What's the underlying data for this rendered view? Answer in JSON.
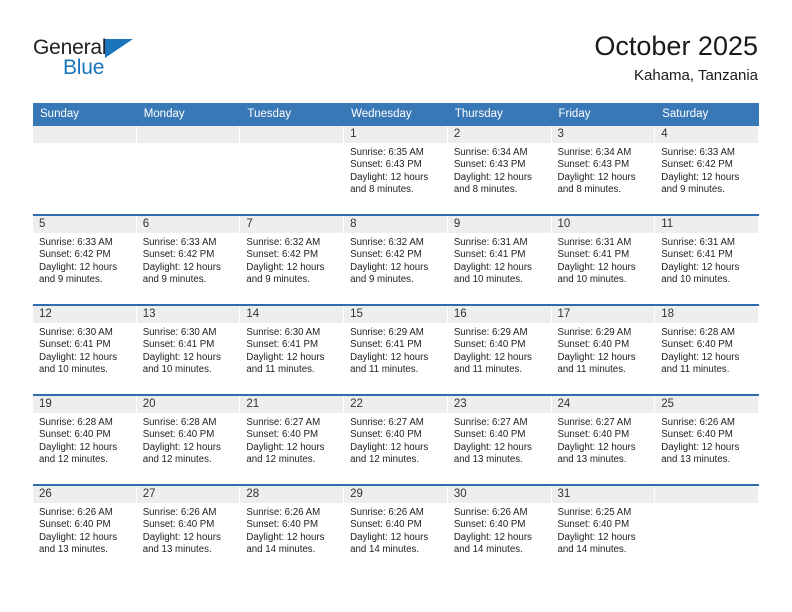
{
  "brand": {
    "name_primary": "General",
    "name_secondary": "Blue",
    "triangle_icon": "triangle-icon",
    "accent_color": "#1b75bb"
  },
  "header": {
    "title": "October 2025",
    "subtitle": "Kahama, Tanzania"
  },
  "colors": {
    "header_row_bg": "#3878b6",
    "week_divider": "#2f6daf",
    "day_band_bg": "#eeeeee",
    "text": "#222222"
  },
  "calendar": {
    "day_headers": [
      "Sunday",
      "Monday",
      "Tuesday",
      "Wednesday",
      "Thursday",
      "Friday",
      "Saturday"
    ],
    "weeks": [
      [
        {
          "day": "",
          "sunrise": "",
          "sunset": "",
          "daylight_line1": "",
          "daylight_line2": "",
          "empty": true
        },
        {
          "day": "",
          "sunrise": "",
          "sunset": "",
          "daylight_line1": "",
          "daylight_line2": "",
          "empty": true
        },
        {
          "day": "",
          "sunrise": "",
          "sunset": "",
          "daylight_line1": "",
          "daylight_line2": "",
          "empty": true
        },
        {
          "day": "1",
          "sunrise": "Sunrise: 6:35 AM",
          "sunset": "Sunset: 6:43 PM",
          "daylight_line1": "Daylight: 12 hours",
          "daylight_line2": "and 8 minutes.",
          "empty": false
        },
        {
          "day": "2",
          "sunrise": "Sunrise: 6:34 AM",
          "sunset": "Sunset: 6:43 PM",
          "daylight_line1": "Daylight: 12 hours",
          "daylight_line2": "and 8 minutes.",
          "empty": false
        },
        {
          "day": "3",
          "sunrise": "Sunrise: 6:34 AM",
          "sunset": "Sunset: 6:43 PM",
          "daylight_line1": "Daylight: 12 hours",
          "daylight_line2": "and 8 minutes.",
          "empty": false
        },
        {
          "day": "4",
          "sunrise": "Sunrise: 6:33 AM",
          "sunset": "Sunset: 6:42 PM",
          "daylight_line1": "Daylight: 12 hours",
          "daylight_line2": "and 9 minutes.",
          "empty": false
        }
      ],
      [
        {
          "day": "5",
          "sunrise": "Sunrise: 6:33 AM",
          "sunset": "Sunset: 6:42 PM",
          "daylight_line1": "Daylight: 12 hours",
          "daylight_line2": "and 9 minutes.",
          "empty": false
        },
        {
          "day": "6",
          "sunrise": "Sunrise: 6:33 AM",
          "sunset": "Sunset: 6:42 PM",
          "daylight_line1": "Daylight: 12 hours",
          "daylight_line2": "and 9 minutes.",
          "empty": false
        },
        {
          "day": "7",
          "sunrise": "Sunrise: 6:32 AM",
          "sunset": "Sunset: 6:42 PM",
          "daylight_line1": "Daylight: 12 hours",
          "daylight_line2": "and 9 minutes.",
          "empty": false
        },
        {
          "day": "8",
          "sunrise": "Sunrise: 6:32 AM",
          "sunset": "Sunset: 6:42 PM",
          "daylight_line1": "Daylight: 12 hours",
          "daylight_line2": "and 9 minutes.",
          "empty": false
        },
        {
          "day": "9",
          "sunrise": "Sunrise: 6:31 AM",
          "sunset": "Sunset: 6:41 PM",
          "daylight_line1": "Daylight: 12 hours",
          "daylight_line2": "and 10 minutes.",
          "empty": false
        },
        {
          "day": "10",
          "sunrise": "Sunrise: 6:31 AM",
          "sunset": "Sunset: 6:41 PM",
          "daylight_line1": "Daylight: 12 hours",
          "daylight_line2": "and 10 minutes.",
          "empty": false
        },
        {
          "day": "11",
          "sunrise": "Sunrise: 6:31 AM",
          "sunset": "Sunset: 6:41 PM",
          "daylight_line1": "Daylight: 12 hours",
          "daylight_line2": "and 10 minutes.",
          "empty": false
        }
      ],
      [
        {
          "day": "12",
          "sunrise": "Sunrise: 6:30 AM",
          "sunset": "Sunset: 6:41 PM",
          "daylight_line1": "Daylight: 12 hours",
          "daylight_line2": "and 10 minutes.",
          "empty": false
        },
        {
          "day": "13",
          "sunrise": "Sunrise: 6:30 AM",
          "sunset": "Sunset: 6:41 PM",
          "daylight_line1": "Daylight: 12 hours",
          "daylight_line2": "and 10 minutes.",
          "empty": false
        },
        {
          "day": "14",
          "sunrise": "Sunrise: 6:30 AM",
          "sunset": "Sunset: 6:41 PM",
          "daylight_line1": "Daylight: 12 hours",
          "daylight_line2": "and 11 minutes.",
          "empty": false
        },
        {
          "day": "15",
          "sunrise": "Sunrise: 6:29 AM",
          "sunset": "Sunset: 6:41 PM",
          "daylight_line1": "Daylight: 12 hours",
          "daylight_line2": "and 11 minutes.",
          "empty": false
        },
        {
          "day": "16",
          "sunrise": "Sunrise: 6:29 AM",
          "sunset": "Sunset: 6:40 PM",
          "daylight_line1": "Daylight: 12 hours",
          "daylight_line2": "and 11 minutes.",
          "empty": false
        },
        {
          "day": "17",
          "sunrise": "Sunrise: 6:29 AM",
          "sunset": "Sunset: 6:40 PM",
          "daylight_line1": "Daylight: 12 hours",
          "daylight_line2": "and 11 minutes.",
          "empty": false
        },
        {
          "day": "18",
          "sunrise": "Sunrise: 6:28 AM",
          "sunset": "Sunset: 6:40 PM",
          "daylight_line1": "Daylight: 12 hours",
          "daylight_line2": "and 11 minutes.",
          "empty": false
        }
      ],
      [
        {
          "day": "19",
          "sunrise": "Sunrise: 6:28 AM",
          "sunset": "Sunset: 6:40 PM",
          "daylight_line1": "Daylight: 12 hours",
          "daylight_line2": "and 12 minutes.",
          "empty": false
        },
        {
          "day": "20",
          "sunrise": "Sunrise: 6:28 AM",
          "sunset": "Sunset: 6:40 PM",
          "daylight_line1": "Daylight: 12 hours",
          "daylight_line2": "and 12 minutes.",
          "empty": false
        },
        {
          "day": "21",
          "sunrise": "Sunrise: 6:27 AM",
          "sunset": "Sunset: 6:40 PM",
          "daylight_line1": "Daylight: 12 hours",
          "daylight_line2": "and 12 minutes.",
          "empty": false
        },
        {
          "day": "22",
          "sunrise": "Sunrise: 6:27 AM",
          "sunset": "Sunset: 6:40 PM",
          "daylight_line1": "Daylight: 12 hours",
          "daylight_line2": "and 12 minutes.",
          "empty": false
        },
        {
          "day": "23",
          "sunrise": "Sunrise: 6:27 AM",
          "sunset": "Sunset: 6:40 PM",
          "daylight_line1": "Daylight: 12 hours",
          "daylight_line2": "and 13 minutes.",
          "empty": false
        },
        {
          "day": "24",
          "sunrise": "Sunrise: 6:27 AM",
          "sunset": "Sunset: 6:40 PM",
          "daylight_line1": "Daylight: 12 hours",
          "daylight_line2": "and 13 minutes.",
          "empty": false
        },
        {
          "day": "25",
          "sunrise": "Sunrise: 6:26 AM",
          "sunset": "Sunset: 6:40 PM",
          "daylight_line1": "Daylight: 12 hours",
          "daylight_line2": "and 13 minutes.",
          "empty": false
        }
      ],
      [
        {
          "day": "26",
          "sunrise": "Sunrise: 6:26 AM",
          "sunset": "Sunset: 6:40 PM",
          "daylight_line1": "Daylight: 12 hours",
          "daylight_line2": "and 13 minutes.",
          "empty": false
        },
        {
          "day": "27",
          "sunrise": "Sunrise: 6:26 AM",
          "sunset": "Sunset: 6:40 PM",
          "daylight_line1": "Daylight: 12 hours",
          "daylight_line2": "and 13 minutes.",
          "empty": false
        },
        {
          "day": "28",
          "sunrise": "Sunrise: 6:26 AM",
          "sunset": "Sunset: 6:40 PM",
          "daylight_line1": "Daylight: 12 hours",
          "daylight_line2": "and 14 minutes.",
          "empty": false
        },
        {
          "day": "29",
          "sunrise": "Sunrise: 6:26 AM",
          "sunset": "Sunset: 6:40 PM",
          "daylight_line1": "Daylight: 12 hours",
          "daylight_line2": "and 14 minutes.",
          "empty": false
        },
        {
          "day": "30",
          "sunrise": "Sunrise: 6:26 AM",
          "sunset": "Sunset: 6:40 PM",
          "daylight_line1": "Daylight: 12 hours",
          "daylight_line2": "and 14 minutes.",
          "empty": false
        },
        {
          "day": "31",
          "sunrise": "Sunrise: 6:25 AM",
          "sunset": "Sunset: 6:40 PM",
          "daylight_line1": "Daylight: 12 hours",
          "daylight_line2": "and 14 minutes.",
          "empty": false
        },
        {
          "day": "",
          "sunrise": "",
          "sunset": "",
          "daylight_line1": "",
          "daylight_line2": "",
          "empty": true
        }
      ]
    ]
  }
}
